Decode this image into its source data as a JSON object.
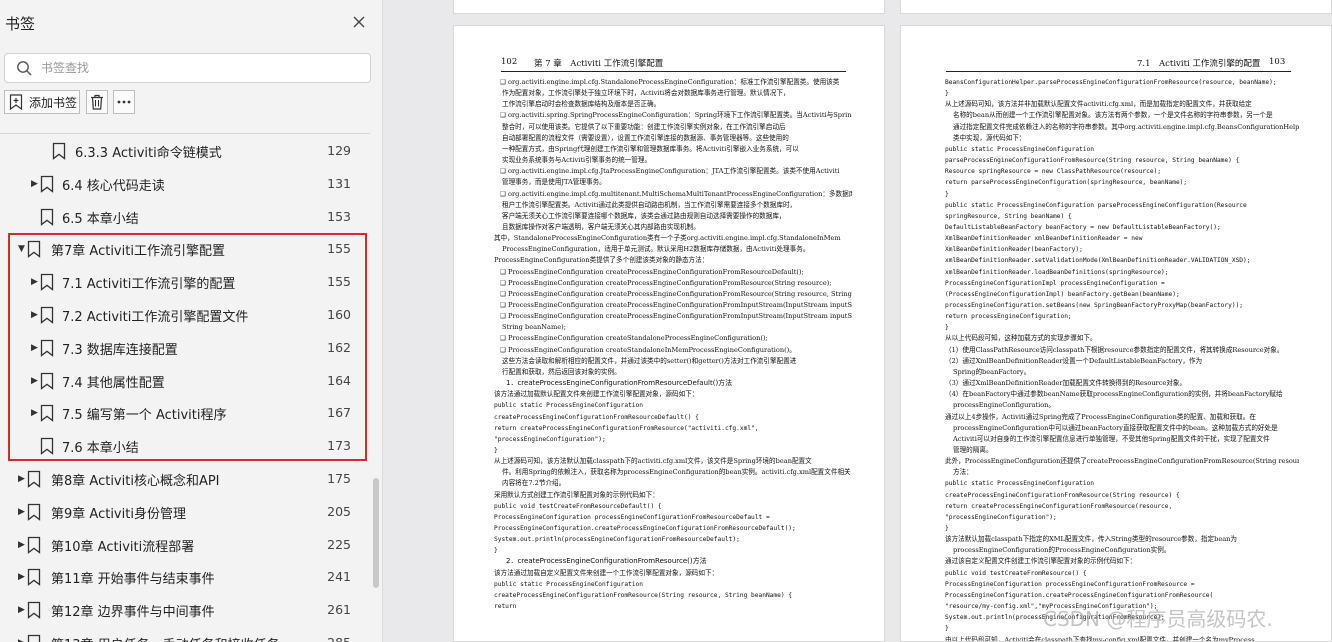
{
  "sidebar": {
    "title": "书签",
    "search_placeholder": "书签查找",
    "add_label": "添加书签",
    "items": [
      {
        "label": "6.3.3 Activiti命令链模式",
        "page": "129",
        "caret": ""
      },
      {
        "label": "6.4 核心代码走读",
        "page": "131",
        "caret": "▶"
      },
      {
        "label": "6.5 本章小结",
        "page": "153",
        "caret": ""
      },
      {
        "label": "第7章 Activiti工作流引擎配置",
        "page": "155",
        "caret": "▼"
      },
      {
        "label": "7.1 Activiti工作流引擎的配置",
        "page": "155",
        "caret": "▶"
      },
      {
        "label": "7.2 Activiti工作流引擎配置文件",
        "page": "160",
        "caret": "▶"
      },
      {
        "label": "7.3 数据库连接配置",
        "page": "162",
        "caret": "▶"
      },
      {
        "label": "7.4 其他属性配置",
        "page": "164",
        "caret": "▶"
      },
      {
        "label": "7.5 编写第一个 Activiti程序",
        "page": "167",
        "caret": "▶"
      },
      {
        "label": "7.6 本章小结",
        "page": "173",
        "caret": ""
      },
      {
        "label": "第8章 Activiti核心概念和API",
        "page": "175",
        "caret": "▶"
      },
      {
        "label": "第9章 Activiti身份管理",
        "page": "205",
        "caret": "▶"
      },
      {
        "label": "第10章 Activiti流程部署",
        "page": "225",
        "caret": "▶"
      },
      {
        "label": "第11章 开始事件与结束事件",
        "page": "241",
        "caret": "▶"
      },
      {
        "label": "第12章 边界事件与中间事件",
        "page": "261",
        "caret": "▶"
      },
      {
        "label": "第13章 用户任务、手动任务和接收任务",
        "page": "285",
        "caret": "▶"
      }
    ]
  },
  "left_page": {
    "page_number": "102",
    "chapter_header": "第 7 章　Activiti 工作流引擎配置",
    "lines": [
      {
        "t": "❑ org.activiti.engine.impl.cfg.StandaloneProcessEngineConfiguration：标准工作流引擎配置类。使用该类",
        "k": "text"
      },
      {
        "t": "作为配置对象，工作流引擎处于独立环境下时，Activiti将会对数据库事务进行管理。默认情况下，",
        "k": "text"
      },
      {
        "t": "工作流引擎启动时会检查数据库结构及版本是否正确。",
        "k": "text"
      },
      {
        "t": "❑ org.activiti.spring.SpringProcessEngineConfiguration：Spring环境下工作流引擎配置类。当Activiti与Spring",
        "k": "text"
      },
      {
        "t": "整合时，可以使用该类。它提供了以下重要功能：创建工作流引擎实例对象，在工作流引擎启动后",
        "k": "text"
      },
      {
        "t": "自动部署配置的流程文件（需要设置），设置工作流引擎连接的数据源、事务管理器等。这些使用的",
        "k": "text"
      },
      {
        "t": "一种配置方式，由Spring代理创建工作流引擎和管理数据库事务。将Activiti引擎嵌入业务系统，可以",
        "k": "text"
      },
      {
        "t": "实现业务系统事务与Activiti引擎事务的统一管理。",
        "k": "text"
      },
      {
        "t": "❑ org.activiti.engine.impl.cfg.JtaProcessEngineConfiguration：JTA工作流引擎配置类。该类不使用Activiti",
        "k": "text"
      },
      {
        "t": "管理事务，而是使用JTA管理事务。",
        "k": "text"
      },
      {
        "t": "❑ org.activiti.engine.impl.cfg.multitenant.MultiSchemaMultiTenantProcessEngineConfiguration：多数据库多",
        "k": "text"
      },
      {
        "t": "租户工作流引擎配置类。Activiti通过此类提供自动路由机制，当工作流引擎需要连接多个数据库时，",
        "k": "text"
      },
      {
        "t": "客户端无须关心工作流引擎要连接哪个数据库，该类会通过路由规则自动选择需要操作的数据库，",
        "k": "text"
      },
      {
        "t": "且数据库操作对客户端透明，客户端无须关心其内部路由实现机制。",
        "k": "text"
      },
      {
        "t": "其中，StandaloneProcessEngineConfiguration类有一个子类org.activiti.engine.impl.cfg.StandaloneInMem",
        "k": "text"
      },
      {
        "t": "ProcessEngineConfiguration，适用于单元测试。默认采用H2数据库存储数据，由Activiti处理事务。",
        "k": "text"
      },
      {
        "t": "ProcessEngineConfiguration类提供了多个创建该类对象的静态方法：",
        "k": "text"
      },
      {
        "t": "❑ ProcessEngineConfiguration createProcessEngineConfigurationFromResourceDefault();",
        "k": "text"
      },
      {
        "t": "❑ ProcessEngineConfiguration createProcessEngineConfigurationFromResource(String resource);",
        "k": "text"
      },
      {
        "t": "❑ ProcessEngineConfiguration createProcessEngineConfigurationFromResource(String resource, String beanName);",
        "k": "text"
      },
      {
        "t": "❑ ProcessEngineConfiguration createProcessEngineConfigurationFromInputStream(InputStream inputStream);",
        "k": "text"
      },
      {
        "t": "❑ ProcessEngineConfiguration createProcessEngineConfigurationFromInputStream(InputStream inputStream,",
        "k": "text"
      },
      {
        "t": "String beanName);",
        "k": "text"
      },
      {
        "t": "❑ ProcessEngineConfiguration createStandaloneProcessEngineConfiguration();",
        "k": "text"
      },
      {
        "t": "❑ ProcessEngineConfiguration createStandaloneInMemProcessEngineConfiguration()。",
        "k": "text"
      },
      {
        "t": "这些方法会读取和解析相应的配置文件，并通过该类中的setter()和getter()方法对工作流引擎配置进",
        "k": "text"
      },
      {
        "t": "行配置和获取，然后返回该对象的实例。",
        "k": "text"
      },
      {
        "t": "1．createProcessEngineConfigurationFromResourceDefault()方法",
        "k": "heading"
      },
      {
        "t": "该方法通过加载默认配置文件来创建工作流引擎配置对象，源码如下：",
        "k": "text"
      },
      {
        "t": "public static ProcessEngineConfiguration",
        "k": "code"
      },
      {
        "t": "  createProcessEngineConfigurationFromResourceDefault() {",
        "k": "code"
      },
      {
        "t": "  return createProcessEngineConfigurationFromResource(\"activiti.cfg.xml\",",
        "k": "code"
      },
      {
        "t": "      \"processEngineConfiguration\");",
        "k": "code"
      },
      {
        "t": "}",
        "k": "code"
      },
      {
        "t": "从上述源码可知，该方法默认加载classpath下的activiti.cfg.xml文件，该文件是Spring环境的bean配置文",
        "k": "text"
      },
      {
        "t": "件。利用Spring的依赖注入，获取名称为processEngineConfiguration的bean实例。activiti.cfg.xml配置文件相关",
        "k": "text"
      },
      {
        "t": "内容将在7.2节介绍。",
        "k": "text"
      },
      {
        "t": "采用默认方式创建工作流引擎配置对象的示例代码如下：",
        "k": "text"
      },
      {
        "t": "public void testCreateFromResourceDefault() {",
        "k": "code"
      },
      {
        "t": "    ProcessEngineConfiguration processEngineConfigurationFromResourceDefault =",
        "k": "code"
      },
      {
        "t": "        ProcessEngineConfiguration.createProcessEngineConfigurationFromResourceDefault();",
        "k": "code"
      },
      {
        "t": "    System.out.println(processEngineConfigurationFromResourceDefault);",
        "k": "code"
      },
      {
        "t": "}",
        "k": "code"
      },
      {
        "t": "2．createProcessEngineConfigurationFromResource()方法",
        "k": "heading"
      },
      {
        "t": "该方法通过加载自定义配置文件来创建一个工作流引擎配置对象，源码如下：",
        "k": "text"
      },
      {
        "t": "public static ProcessEngineConfiguration",
        "k": "code"
      },
      {
        "t": "  createProcessEngineConfigurationFromResource(String resource, String beanName) {",
        "k": "code"
      },
      {
        "t": "  return",
        "k": "code"
      }
    ]
  },
  "right_page": {
    "page_number": "103",
    "section_header": "7.1　Activiti 工作流引擎的配置",
    "lines": [
      {
        "t": "BeansConfigurationHelper.parseProcessEngineConfigurationFromResource(resource, beanName);",
        "k": "code"
      },
      {
        "t": "}",
        "k": "code"
      },
      {
        "t": "从上述源码可知，该方法并非加载默认配置文件activiti.cfg.xml，而是加载指定的配置文件，并获取给定",
        "k": "text"
      },
      {
        "t": "名称的bean从而创建一个工作流引擎配置对象。该方法有两个参数，一个是文件名称的字符串参数，另一个是",
        "k": "text"
      },
      {
        "t": "通过指定配置文件完成依赖注入的名称的字符串参数。其中org.activiti.engine.impl.cfg.BeansConfigurationHelper",
        "k": "text"
      },
      {
        "t": "类中实现，源代码如下：",
        "k": "text"
      },
      {
        "t": "public static ProcessEngineConfiguration",
        "k": "code"
      },
      {
        "t": "    parseProcessEngineConfigurationFromResource(String resource, String beanName) {",
        "k": "code"
      },
      {
        "t": "    Resource springResource = new ClassPathResource(resource);",
        "k": "code"
      },
      {
        "t": "    return parseProcessEngineConfiguration(springResource, beanName);",
        "k": "code"
      },
      {
        "t": "}",
        "k": "code"
      },
      {
        "t": "public static ProcessEngineConfiguration parseProcessEngineConfiguration(Resource",
        "k": "code"
      },
      {
        "t": "    springResource, String beanName) {",
        "k": "code"
      },
      {
        "t": "    DefaultListableBeanFactory beanFactory = new DefaultListableBeanFactory();",
        "k": "code"
      },
      {
        "t": "    XmlBeanDefinitionReader xmlBeanDefinitionReader = new",
        "k": "code"
      },
      {
        "t": "        XmlBeanDefinitionReader(beanFactory);",
        "k": "code"
      },
      {
        "t": "    xmlBeanDefinitionReader.setValidationMode(XmlBeanDefinitionReader.VALIDATION_XSD);",
        "k": "code"
      },
      {
        "t": "    xmlBeanDefinitionReader.loadBeanDefinitions(springResource);",
        "k": "code"
      },
      {
        "t": "    ProcessEngineConfigurationImpl processEngineConfiguration =",
        "k": "code"
      },
      {
        "t": "        (ProcessEngineConfigurationImpl) beanFactory.getBean(beanName);",
        "k": "code"
      },
      {
        "t": "    processEngineConfiguration.setBeans(new SpringBeanFactoryProxyMap(beanFactory));",
        "k": "code"
      },
      {
        "t": "    return processEngineConfiguration;",
        "k": "code"
      },
      {
        "t": "}",
        "k": "code"
      },
      {
        "t": "从以上代码段可知，这种加载方式的实现步骤如下。",
        "k": "text"
      },
      {
        "t": "（1）使用ClassPathResource访问classpath下根据resource参数指定的配置文件，将其转换成Resource对象。",
        "k": "text"
      },
      {
        "t": "（2）通过XmlBeanDefinitionReader设置一个DefaultListableBeanFactory，作为",
        "k": "text"
      },
      {
        "t": "Spring的beanFactory。",
        "k": "text"
      },
      {
        "t": "（3）通过XmlBeanDefinitionReader加载配置文件转换得到的Resource对象。",
        "k": "text"
      },
      {
        "t": "（4）在beanFactory中通过参数beanName获取processEngineConfiguration的实例，并将beanFactory赋给",
        "k": "text"
      },
      {
        "t": "processEngineConfiguration。",
        "k": "text"
      },
      {
        "t": "通过以上4步操作，Activiti通过Spring完成了ProcessEngineConfiguration类的配置、加载和获取。在",
        "k": "text"
      },
      {
        "t": "processEngineConfiguration中可以通过beanFactory直接获取配置文件中的bean。这种加载方式的好处是",
        "k": "text"
      },
      {
        "t": "Activiti可以对自身的工作流引擎配置信息进行单独管理，不受其他Spring配置文件的干扰，实现了配置文件",
        "k": "text"
      },
      {
        "t": "管理的隔离。",
        "k": "text"
      },
      {
        "t": "此外，ProcessEngineConfiguration还提供了createProcessEngineConfigurationFromResource(String resource)",
        "k": "text"
      },
      {
        "t": "方法：",
        "k": "text"
      },
      {
        "t": "public static ProcessEngineConfiguration",
        "k": "code"
      },
      {
        "t": "    createProcessEngineConfigurationFromResource(String resource) {",
        "k": "code"
      },
      {
        "t": "    return createProcessEngineConfigurationFromResource(resource,",
        "k": "code"
      },
      {
        "t": "        \"processEngineConfiguration\");",
        "k": "code"
      },
      {
        "t": "}",
        "k": "code"
      },
      {
        "t": "该方法默认加载classpath下指定的XML配置文件，传入String类型的resource参数，指定bean为",
        "k": "text"
      },
      {
        "t": "processEngineConfiguration的ProcessEngineConfiguration实例。",
        "k": "text"
      },
      {
        "t": "通过该自定义配置文件创建工作流引擎配置对象的示例代码如下：",
        "k": "text"
      },
      {
        "t": "public void testCreateFromResource() {",
        "k": "code"
      },
      {
        "t": "    ProcessEngineConfiguration processEngineConfigurationFromResource =",
        "k": "code"
      },
      {
        "t": "        ProcessEngineConfiguration.createProcessEngineConfigurationFromResource(",
        "k": "code"
      },
      {
        "t": "        \"resource/my-config.xml\",\"myProcessEngineConfiguration\");",
        "k": "code"
      },
      {
        "t": "    System.out.println(processEngineConfigurationFromResource);",
        "k": "code"
      },
      {
        "t": "}",
        "k": "code"
      },
      {
        "t": "由以上代码段可知，Activiti会在classpath下查找my-config.xml配置文件，并创建一个名为myProcess",
        "k": "text"
      },
      {
        "t": "EngineConfiguration的工作流引擎配置对象。",
        "k": "text"
      }
    ]
  },
  "watermark": "CSDN @程序员高级码农.",
  "colors": {
    "highlight": "#d42b2b",
    "sidebar_bg": "#f3f3f3",
    "viewer_bg": "#e9e9ec"
  }
}
